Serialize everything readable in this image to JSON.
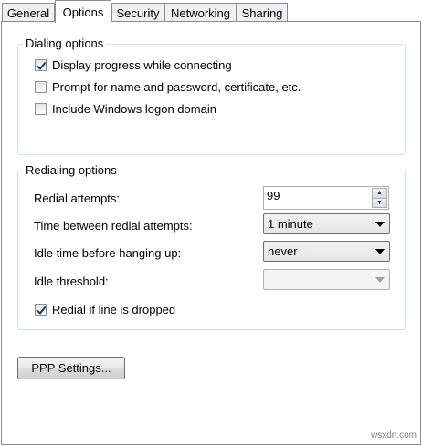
{
  "tabs": [
    {
      "label": "General",
      "active": false
    },
    {
      "label": "Options",
      "active": true
    },
    {
      "label": "Security",
      "active": false
    },
    {
      "label": "Networking",
      "active": false
    },
    {
      "label": "Sharing",
      "active": false
    }
  ],
  "dialing": {
    "title": "Dialing options",
    "options": [
      {
        "label": "Display progress while connecting",
        "checked": true
      },
      {
        "label": "Prompt for name and password, certificate, etc.",
        "checked": false
      },
      {
        "label": "Include Windows logon domain",
        "checked": false
      }
    ]
  },
  "redialing": {
    "title": "Redialing options",
    "redial_attempts_label": "Redial attempts:",
    "redial_attempts_value": "99",
    "time_between_label": "Time between redial attempts:",
    "time_between_value": "1 minute",
    "idle_time_label": "Idle time before hanging up:",
    "idle_time_value": "never",
    "idle_threshold_label": "Idle threshold:",
    "idle_threshold_value": "",
    "redial_dropped_label": "Redial if line is dropped",
    "redial_dropped_checked": true
  },
  "ppp_button_label": "PPP Settings...",
  "watermark": "wsxdn.com",
  "icons": {
    "spin_up": "spin-up-icon",
    "spin_down": "spin-down-icon",
    "dropdown": "dropdown-arrow-icon",
    "checkmark": "checkmark-icon"
  }
}
